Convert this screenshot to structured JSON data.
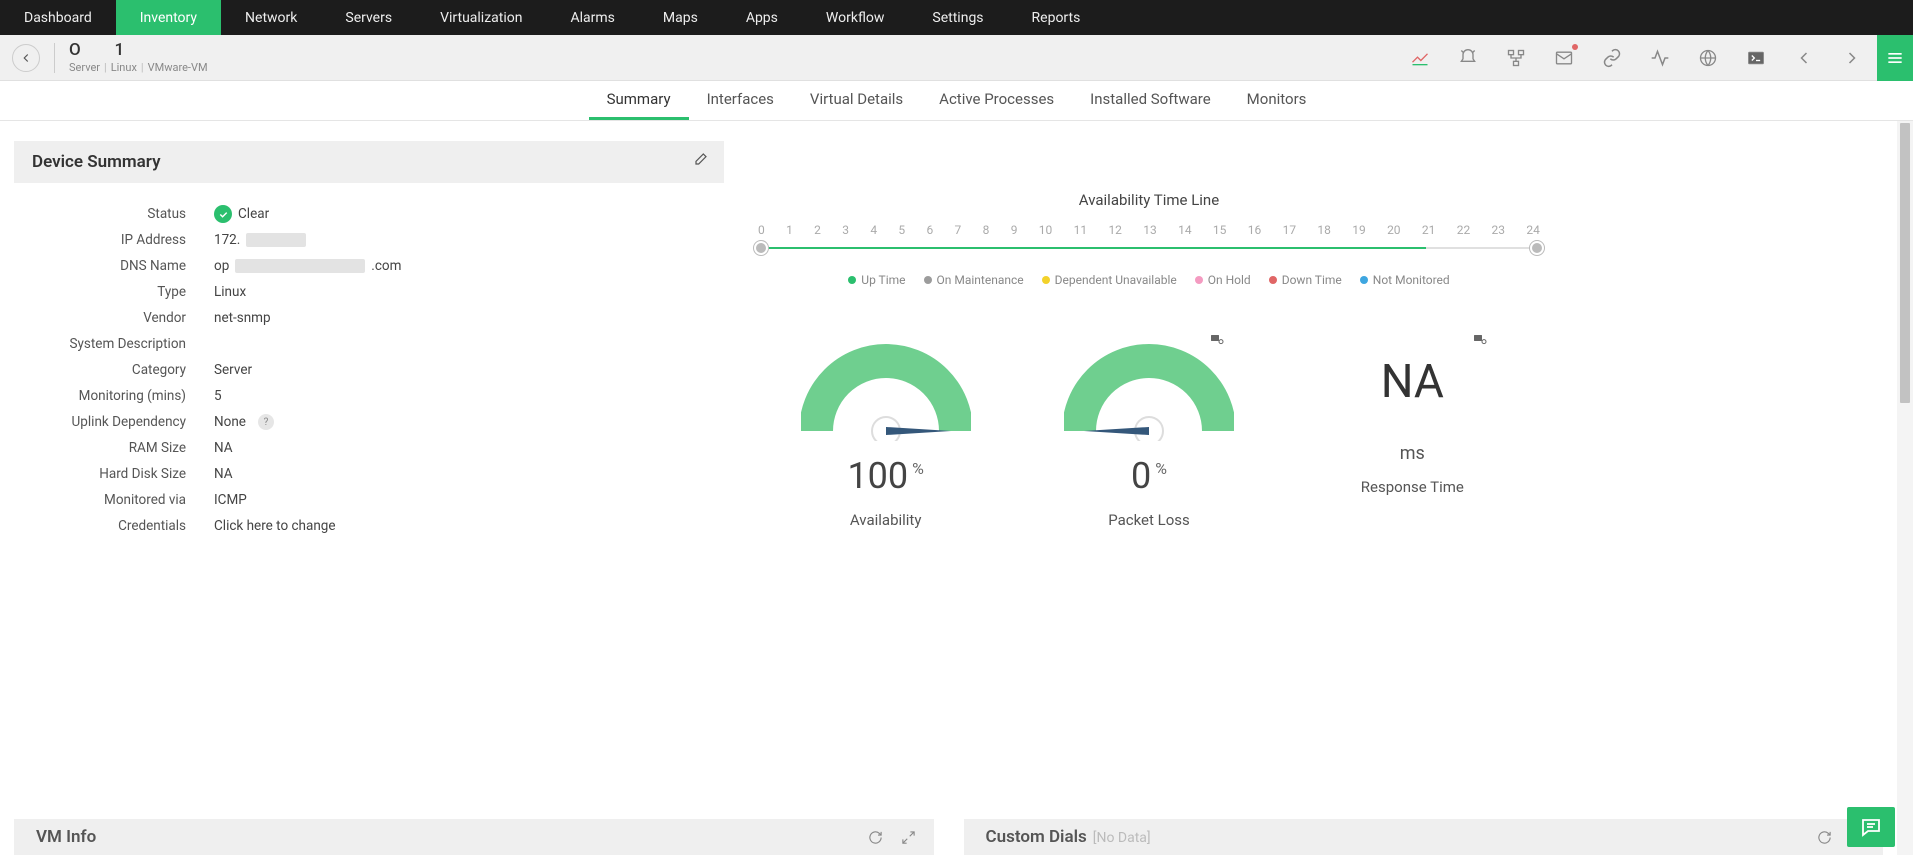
{
  "topnav": [
    "Dashboard",
    "Inventory",
    "Network",
    "Servers",
    "Virtualization",
    "Alarms",
    "Maps",
    "Apps",
    "Workflow",
    "Settings",
    "Reports"
  ],
  "topnav_active_index": 1,
  "subheader": {
    "title_prefix": "O",
    "title_suffix": "1",
    "breadcrumb": [
      "Server",
      "Linux",
      "VMware-VM"
    ]
  },
  "tabs": [
    "Summary",
    "Interfaces",
    "Virtual Details",
    "Active Processes",
    "Installed Software",
    "Monitors"
  ],
  "tabs_active_index": 0,
  "panel": {
    "title": "Device Summary",
    "rows": {
      "status_label": "Status",
      "status_value": "Clear",
      "ip_label": "IP Address",
      "ip_prefix": "172.",
      "dns_label": "DNS Name",
      "dns_prefix": "op",
      "dns_suffix": ".com",
      "type_label": "Type",
      "type_value": "Linux",
      "vendor_label": "Vendor",
      "vendor_value": "net-snmp",
      "sysdesc_label": "System Description",
      "sysdesc_value": "",
      "category_label": "Category",
      "category_value": "Server",
      "monitoring_label": "Monitoring (mins)",
      "monitoring_value": "5",
      "uplink_label": "Uplink Dependency",
      "uplink_value": "None",
      "ram_label": "RAM Size",
      "ram_value": "NA",
      "hdd_label": "Hard Disk Size",
      "hdd_value": "NA",
      "monvia_label": "Monitored via",
      "monvia_value": "ICMP",
      "cred_label": "Credentials",
      "cred_value": "Click here to change"
    }
  },
  "timeline": {
    "title": "Availability Time Line",
    "ticks": [
      "0",
      "1",
      "2",
      "3",
      "4",
      "5",
      "6",
      "7",
      "8",
      "9",
      "10",
      "11",
      "12",
      "13",
      "14",
      "15",
      "16",
      "17",
      "18",
      "19",
      "20",
      "21",
      "22",
      "23",
      "24"
    ],
    "legend": [
      {
        "label": "Up Time",
        "color": "#2bbf6e"
      },
      {
        "label": "On Maintenance",
        "color": "#9c9c9c"
      },
      {
        "label": "Dependent Unavailable",
        "color": "#f3d22b"
      },
      {
        "label": "On Hold",
        "color": "#f49bc1"
      },
      {
        "label": "Down Time",
        "color": "#e06666"
      },
      {
        "label": "Not Monitored",
        "color": "#3ea6e0"
      }
    ]
  },
  "gauges": {
    "availability": {
      "value": "100",
      "unit": "%",
      "label": "Availability"
    },
    "packetloss": {
      "value": "0",
      "unit": "%",
      "label": "Packet Loss"
    },
    "responsetime": {
      "value": "NA",
      "unit": "ms",
      "label": "Response Time"
    }
  },
  "bottom": {
    "vm_title": "VM Info",
    "custom_title": "Custom Dials",
    "nodata": "[No Data]"
  },
  "help_q": "?"
}
